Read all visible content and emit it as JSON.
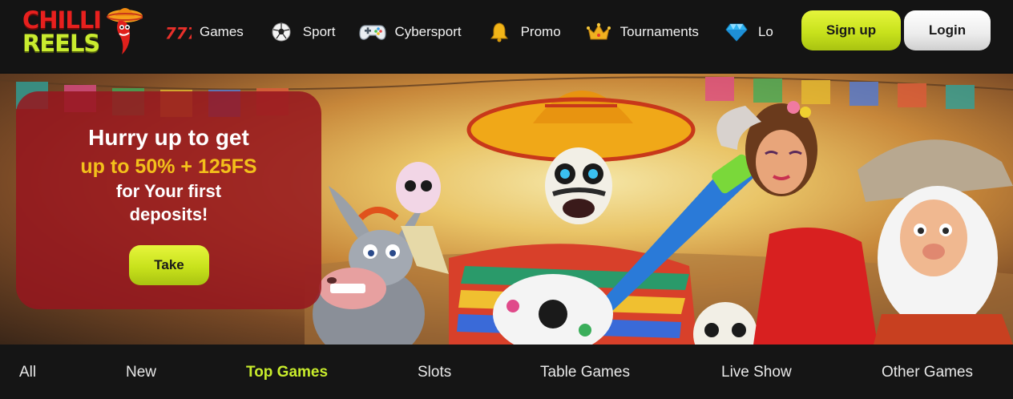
{
  "brand": {
    "logo_line1": "CHILLI",
    "logo_line2": "REELS"
  },
  "nav": {
    "items": [
      {
        "label": "Games",
        "icon": "slot-777-icon"
      },
      {
        "label": "Sport",
        "icon": "soccer-ball-icon"
      },
      {
        "label": "Cybersport",
        "icon": "gamepad-icon"
      },
      {
        "label": "Promo",
        "icon": "bell-icon"
      },
      {
        "label": "Tournaments",
        "icon": "crown-icon"
      },
      {
        "label": "Lo",
        "icon": "diamond-icon"
      }
    ]
  },
  "auth": {
    "signup_label": "Sign up",
    "login_label": "Login"
  },
  "banner": {
    "line1": "Hurry up to get",
    "line2": "up to 50% + 125FS",
    "line3": "for Your first",
    "line4": "deposits!",
    "cta_label": "Take"
  },
  "categories": {
    "tabs": [
      {
        "label": "All",
        "active": false
      },
      {
        "label": "New",
        "active": false
      },
      {
        "label": "Top Games",
        "active": true
      },
      {
        "label": "Slots",
        "active": false
      },
      {
        "label": "Table Games",
        "active": false
      },
      {
        "label": "Live Show",
        "active": false
      },
      {
        "label": "Other Games",
        "active": false
      }
    ]
  },
  "colors": {
    "accent_lime": "#c8ec2c",
    "promo_gold": "#f3c01b",
    "promo_card": "#96161e",
    "header_bg": "#141414",
    "brand_red": "#e8201e"
  }
}
